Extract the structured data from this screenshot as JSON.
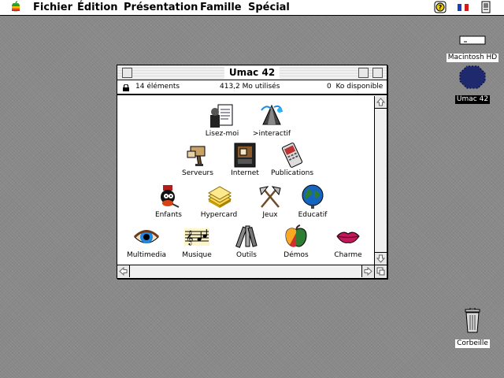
{
  "menubar": {
    "items": [
      "Fichier",
      "Édition",
      "Présentation",
      "Famille",
      "Spécial"
    ]
  },
  "desktop": {
    "hd_label": "Macintosh HD",
    "disk_label": "Umac 42",
    "trash_label": "Corbeille"
  },
  "window": {
    "title": "Umac 42",
    "info": {
      "items": "14 éléments",
      "used": "413,2 Mo utilisés",
      "available": "0  Ko disponible"
    },
    "items": [
      {
        "label": "Lisez-moi",
        "icon": "document-icon"
      },
      {
        "label": ">interactif",
        "icon": "interactive-icon"
      },
      {
        "label": "Serveurs",
        "icon": "servers-icon"
      },
      {
        "label": "Internet",
        "icon": "internet-icon"
      },
      {
        "label": "Publications",
        "icon": "publications-icon"
      },
      {
        "label": "Enfants",
        "icon": "children-icon"
      },
      {
        "label": "Hypercard",
        "icon": "hypercard-icon"
      },
      {
        "label": "Jeux",
        "icon": "games-icon"
      },
      {
        "label": "Educatif",
        "icon": "globe-icon"
      },
      {
        "label": "Multimedia",
        "icon": "eye-icon"
      },
      {
        "label": "Musique",
        "icon": "music-icon"
      },
      {
        "label": "Outils",
        "icon": "tools-icon"
      },
      {
        "label": "Démos",
        "icon": "apple-icon"
      },
      {
        "label": "Charme",
        "icon": "lips-icon"
      }
    ]
  }
}
